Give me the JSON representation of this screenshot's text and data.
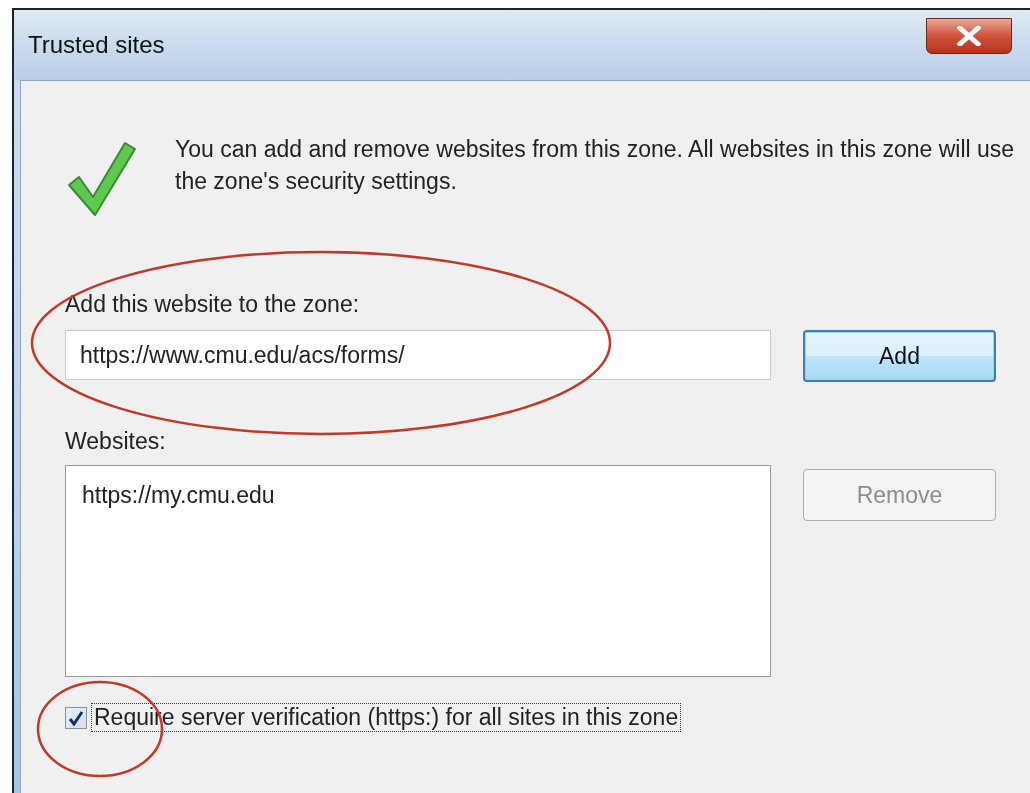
{
  "window": {
    "title": "Trusted sites"
  },
  "description": "You can add and remove websites from this zone. All websites in this zone will use the zone's security settings.",
  "add_field": {
    "label": "Add this website to the zone:",
    "value": "https://www.cmu.edu/acs/forms/",
    "circled": true
  },
  "add_button": {
    "label": "Add",
    "focused": true,
    "disabled": false
  },
  "websites": {
    "label": "Websites:",
    "items": [
      "https://my.cmu.edu"
    ]
  },
  "remove_button": {
    "label": "Remove",
    "focused": false,
    "disabled": true
  },
  "require_verification": {
    "label": "Require server verification (https:) for all sites in this zone",
    "checked": true,
    "circled": true
  }
}
